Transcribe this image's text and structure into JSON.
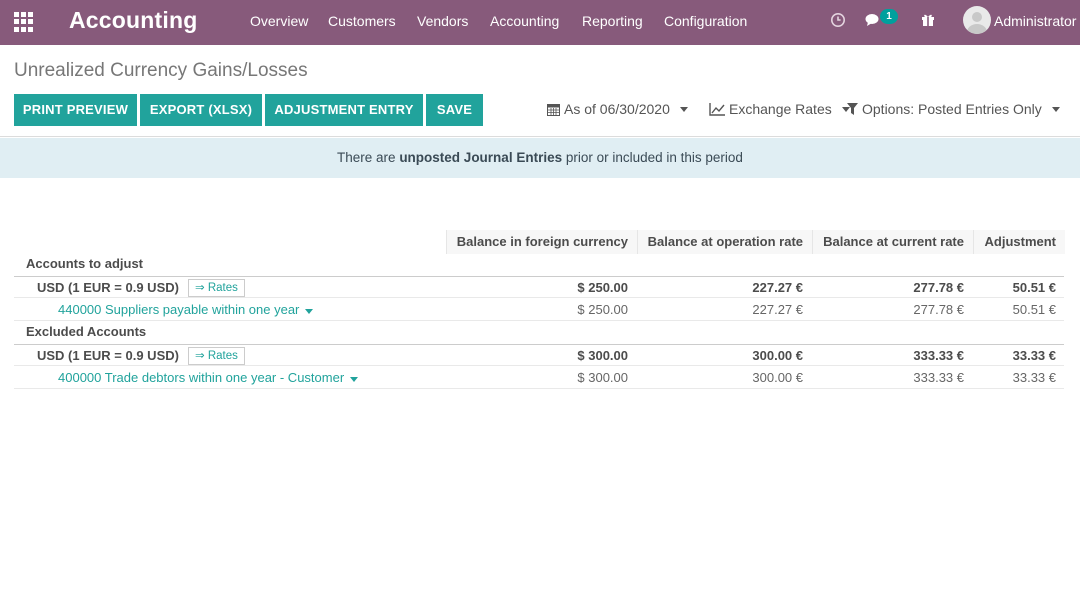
{
  "navbar": {
    "app_name": "Accounting",
    "menu": [
      "Overview",
      "Customers",
      "Vendors",
      "Accounting",
      "Reporting",
      "Configuration"
    ],
    "chat_count": "1",
    "user": "Administrator",
    "color": "#875a7b"
  },
  "page": {
    "title": "Unrealized Currency Gains/Losses"
  },
  "buttons": {
    "print_preview": "PRINT PREVIEW",
    "export": "EXPORT (XLSX)",
    "adjustment": "ADJUSTMENT ENTRY",
    "save": "SAVE",
    "color": "#21a39c"
  },
  "filters": {
    "date": "As of 06/30/2020",
    "exchange": "Exchange Rates",
    "options": "Options: Posted Entries Only"
  },
  "alert": {
    "prefix": "There are ",
    "bold": "unposted Journal Entries",
    "suffix": " prior or included in this period"
  },
  "report": {
    "columns": [
      "Balance in foreign currency",
      "Balance at operation rate",
      "Balance at current rate",
      "Adjustment"
    ],
    "sections": [
      {
        "title": "Accounts to adjust",
        "currency": "USD (1 EUR = 0.9 USD)",
        "rates_label": "⇒ Rates",
        "totals": [
          "$ 250.00",
          "227.27 €",
          "277.78 €",
          "50.51 €"
        ],
        "account": "440000 Suppliers payable within one year",
        "values": [
          "$ 250.00",
          "227.27 €",
          "277.78 €",
          "50.51 €"
        ]
      },
      {
        "title": "Excluded Accounts",
        "currency": "USD (1 EUR = 0.9 USD)",
        "rates_label": "⇒ Rates",
        "totals": [
          "$ 300.00",
          "300.00 €",
          "333.33 €",
          "33.33 €"
        ],
        "account": "400000 Trade debtors within one year - Customer",
        "values": [
          "$ 300.00",
          "300.00 €",
          "333.33 €",
          "33.33 €"
        ]
      }
    ]
  },
  "icons": {
    "apps": "apps-grid-icon",
    "clock": "clock-icon",
    "chat": "chat-icon",
    "gift": "gift-icon",
    "calendar": "calendar-icon",
    "chart": "line-chart-icon",
    "filter": "filter-icon"
  }
}
